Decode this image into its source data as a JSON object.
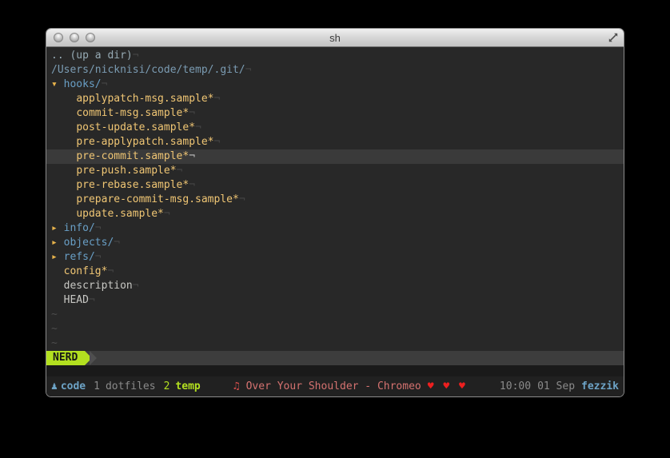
{
  "window": {
    "title": "sh",
    "buttons": [
      "close",
      "minimize",
      "zoom"
    ]
  },
  "colors": {
    "bg_vim": "#282828",
    "bg_cursorline": "#3a3a3a",
    "bg_statusline": "#3d3d3d",
    "bg_gap": "#1a1a1a",
    "bg_tmux": "#212121",
    "updir": "#97abb5",
    "root_path": "#7b9cb3",
    "directory": "#699fc6",
    "expander_arrow": "#e8b34b",
    "file_executable": "#f0c674",
    "file_plain": "#c8c8c4",
    "tilde": "#4d4d4d",
    "eol_marker": "#464646",
    "eol_marker_cursor": "#c0c0c0",
    "green": "#b3e020",
    "blue": "#6da3c6",
    "gray_text": "#8a8a8a",
    "red_note": "#e0514f",
    "red_song": "#d57270",
    "red_heart": "#ed1f1f"
  },
  "eol_char": "¬",
  "tilde_char": "~",
  "tree": {
    "rows": [
      {
        "type": "updir",
        "label": ".. (up a dir)",
        "indent": 0
      },
      {
        "type": "root",
        "label": "/Users/nicknisi/code/temp/.git/",
        "indent": 0
      },
      {
        "type": "dir",
        "label": "hooks/",
        "indent": 0,
        "arrow": "▾",
        "open": true
      },
      {
        "type": "file",
        "label": "applypatch-msg.sample*",
        "indent": 4
      },
      {
        "type": "file",
        "label": "commit-msg.sample*",
        "indent": 4
      },
      {
        "type": "file",
        "label": "post-update.sample*",
        "indent": 4
      },
      {
        "type": "file",
        "label": "pre-applypatch.sample*",
        "indent": 4
      },
      {
        "type": "file",
        "label": "pre-commit.sample*",
        "indent": 4,
        "cursor": true
      },
      {
        "type": "file",
        "label": "pre-push.sample*",
        "indent": 4
      },
      {
        "type": "file",
        "label": "pre-rebase.sample*",
        "indent": 4
      },
      {
        "type": "file",
        "label": "prepare-commit-msg.sample*",
        "indent": 4
      },
      {
        "type": "file",
        "label": "update.sample*",
        "indent": 4
      },
      {
        "type": "dir",
        "label": "info/",
        "indent": 0,
        "arrow": "▸",
        "open": false
      },
      {
        "type": "dir",
        "label": "objects/",
        "indent": 0,
        "arrow": "▸",
        "open": false
      },
      {
        "type": "dir",
        "label": "refs/",
        "indent": 0,
        "arrow": "▸",
        "open": false
      },
      {
        "type": "file",
        "label": "config*",
        "indent": 2
      },
      {
        "type": "plain",
        "label": "description",
        "indent": 2
      },
      {
        "type": "plain",
        "label": "HEAD",
        "indent": 2
      },
      {
        "type": "tilde"
      },
      {
        "type": "tilde"
      },
      {
        "type": "tilde"
      }
    ]
  },
  "statusline": {
    "mode_label": "NERD"
  },
  "tmux": {
    "session_icon": "♟",
    "session_name": "code",
    "windows": [
      {
        "index": "1",
        "name": "dotfiles",
        "active": false
      },
      {
        "index": "2",
        "name": "temp",
        "active": true
      }
    ],
    "music_icon": "♫",
    "song": "Over Your Shoulder - Chromeo",
    "hearts": "♥ ♥ ♥",
    "time": "10:00",
    "date": "01 Sep",
    "host": "fezzik"
  }
}
